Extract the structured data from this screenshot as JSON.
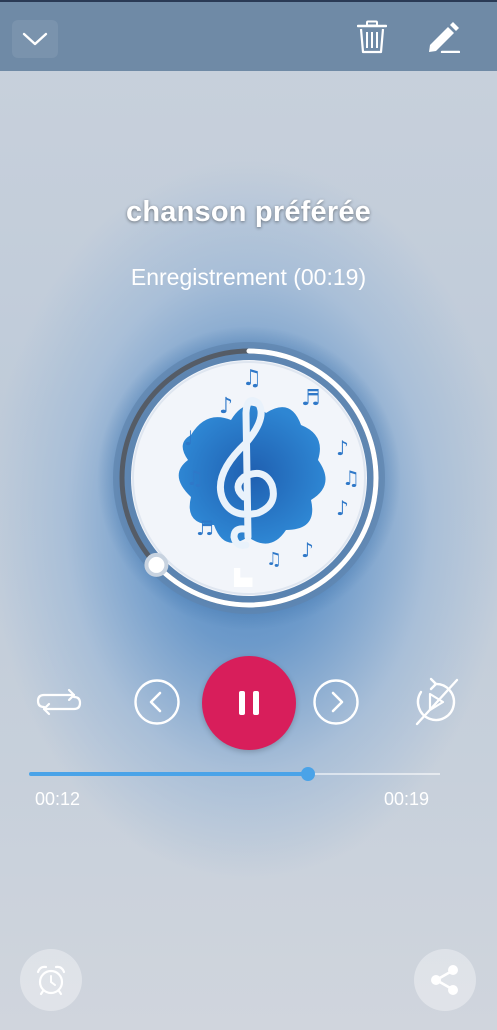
{
  "header": {
    "collapse_icon": "chevron-down-icon",
    "delete_icon": "trash-icon",
    "edit_icon": "pencil-icon"
  },
  "track": {
    "title": "chanson préférée",
    "subtitle": "Enregistrement (00:19)",
    "artwork_icon": "treble-clef-music-notes-icon",
    "progress_ring_fraction": 0.63
  },
  "controls": {
    "repeat_icon": "repeat-icon",
    "previous_icon": "chevron-left-circle-icon",
    "play_pause_icon": "pause-icon",
    "next_icon": "chevron-right-circle-icon",
    "autoplay_icon": "autoplay-off-icon"
  },
  "seek": {
    "current_time": "00:12",
    "total_time": "00:19",
    "progress": 0.68
  },
  "footer": {
    "alarm_icon": "alarm-clock-icon",
    "share_icon": "share-icon"
  },
  "colors": {
    "accent": "#d81e5b",
    "seek": "#4aa3e8",
    "topbar": "#6f8aa6"
  }
}
